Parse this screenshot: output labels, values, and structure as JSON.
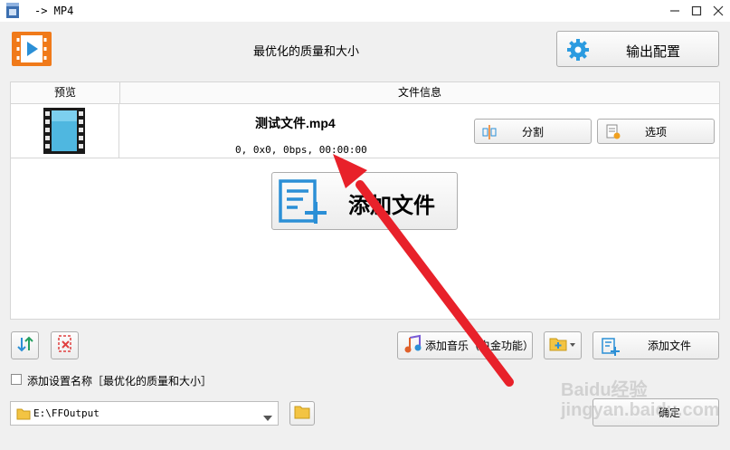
{
  "window": {
    "title": "-> MP4"
  },
  "header": {
    "preset_name": "最优化的质量和大小",
    "output_config_label": "输出配置"
  },
  "table": {
    "col_preview": "预览",
    "col_info": "文件信息",
    "rows": [
      {
        "filename": "测试文件.mp4",
        "meta": "0, 0x0, 0bps, 00:00:00",
        "split_label": "分割",
        "options_label": "选项"
      }
    ],
    "big_add_label": "添加文件"
  },
  "toolbar": {
    "add_music_label": "添加音乐（白金功能）",
    "add_file_label": "添加文件"
  },
  "options": {
    "add_setting_name_label": "添加设置名称［最优化的质量和大小］"
  },
  "output": {
    "path": "E:\\FFOutput",
    "ok_label": "确定"
  },
  "watermark": "Baidu经验 jingyan.baidu.com",
  "colors": {
    "accent_orange": "#f07a1a",
    "accent_blue": "#2b8fd6",
    "arrow_red": "#e8212a"
  }
}
